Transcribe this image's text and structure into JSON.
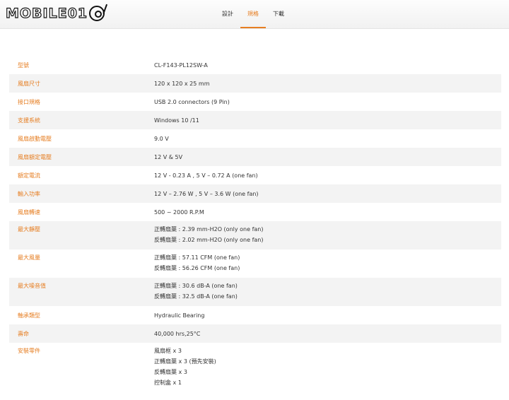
{
  "header": {
    "logo_text": "MOBILE01",
    "tabs": [
      {
        "label": "設計",
        "active": false
      },
      {
        "label": "規格",
        "active": true
      },
      {
        "label": "下載",
        "active": false
      }
    ]
  },
  "specs": [
    {
      "label": "型號",
      "values": [
        "CL-F143-PL12SW-A"
      ]
    },
    {
      "label": "風扇尺寸",
      "values": [
        "120 x 120 x 25 mm"
      ]
    },
    {
      "label": "接口規格",
      "values": [
        "USB 2.0 connectors (9 Pin)"
      ]
    },
    {
      "label": "支援系統",
      "values": [
        "Windows 10 /11"
      ]
    },
    {
      "label": "風扇啟動電壓",
      "values": [
        "9.0 V"
      ]
    },
    {
      "label": "風扇額定電壓",
      "values": [
        "12 V & 5V"
      ]
    },
    {
      "label": "額定電流",
      "values": [
        "12 V - 0.23 A , 5 V – 0.72 A (one fan)"
      ]
    },
    {
      "label": "輸入功率",
      "values": [
        "12 V – 2.76 W , 5 V – 3.6 W (one fan)"
      ]
    },
    {
      "label": "風扇轉速",
      "values": [
        "500 ~ 2000 R.P.M"
      ]
    },
    {
      "label": "最大靜壓",
      "values": [
        "正轉扇葉 : 2.39 mm-H2O (only one fan)",
        "反轉扇葉 : 2.02 mm-H2O (only one fan)"
      ]
    },
    {
      "label": "最大風量",
      "values": [
        "正轉扇葉 : 57.11 CFM (one fan)",
        "反轉扇葉 : 56.26 CFM (one fan)"
      ]
    },
    {
      "label": "最大噪音值",
      "values": [
        "正轉扇葉 : 30.6 dB-A (one fan)",
        "反轉扇葉 : 32.5 dB-A (one fan)"
      ]
    },
    {
      "label": "軸承類型",
      "values": [
        "Hydraulic Bearing"
      ]
    },
    {
      "label": "壽命",
      "values": [
        "40,000 hrs,25°C"
      ]
    },
    {
      "label": "安裝零件",
      "values": [
        "風扇框 x 3",
        "正轉扇葉 x 3 (預先安裝)",
        "反轉扇葉 x 3",
        "控制盒 x 1"
      ]
    }
  ],
  "colors": {
    "accent": "#e67e22",
    "stripe": "#f3f3f3"
  }
}
